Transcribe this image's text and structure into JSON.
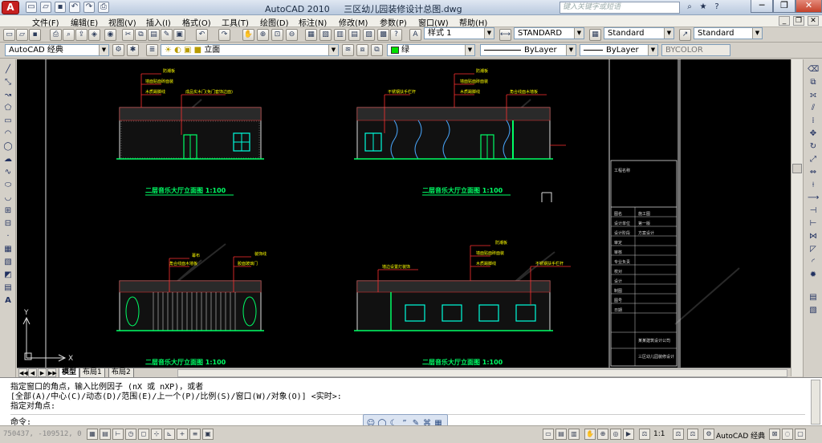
{
  "titlebar": {
    "app_letter": "A",
    "app_name": "AutoCAD 2010",
    "doc_name": "三区幼儿园装修设计总图.dwg",
    "search_placeholder": "键入关键字或短语",
    "quick_access": [
      "new-icon",
      "open-icon",
      "save-icon",
      "undo-icon",
      "redo-icon",
      "plot-icon"
    ],
    "right_icons": [
      "binoculars-icon",
      "star-icon",
      "help-icon"
    ],
    "controls": {
      "minimize": "─",
      "restore": "❐",
      "close": "✕"
    }
  },
  "menubar": {
    "items": [
      "文件(F)",
      "编辑(E)",
      "视图(V)",
      "插入(I)",
      "格式(O)",
      "工具(T)",
      "绘图(D)",
      "标注(N)",
      "修改(M)",
      "参数(P)",
      "窗口(W)",
      "帮助(H)"
    ]
  },
  "toolbar1": {
    "text_style": "样式 1",
    "dim_style": "STANDARD",
    "table_style": "Standard",
    "mleader_style": "Standard"
  },
  "toolbar2": {
    "workspace": "AutoCAD 经典",
    "layer": "立面",
    "color": "绿",
    "linetype": "ByLayer",
    "lineweight": "ByLayer",
    "plotstyle": "BYCOLOR",
    "color_hex": "#00e000"
  },
  "drawings": [
    {
      "title": "二层音乐大厅立面图  1:100",
      "notes": [
        "防潮板",
        "墙面贴面砖面装",
        "木质踢脚线",
        "成品实木门(免门套饰边面)"
      ]
    },
    {
      "title": "二层音乐大厅立面图  1:100",
      "notes": [
        "防潮板",
        "墙面贴面砖面装",
        "木质踢脚线",
        "不锈钢扶手栏杆",
        "角合线面木墙板"
      ]
    },
    {
      "title": "二层音乐大厅立面图  1:100",
      "notes": [
        "幕布",
        "角合线面木墙板",
        "胶面玻璃门",
        "装饰线"
      ]
    },
    {
      "title": "二层音乐大厅立面图  1:100",
      "notes": [
        "防潮板",
        "墙面贴面砖面装",
        "木质踢脚线",
        "不锈钢扶手栏杆",
        "墙边设置灯装饰"
      ]
    }
  ],
  "titleblock": {
    "rows": [
      "工程名称",
      "图名",
      "设计单位",
      "设计阶段",
      "审定",
      "审核",
      "专业负责",
      "校对",
      "设计",
      "制图",
      "图号",
      "日期"
    ],
    "values": [
      "施工图",
      "第一版",
      "方案设计"
    ],
    "company": "某某建筑设计公司",
    "project": "三区幼儿园装修设计"
  },
  "ucs": {
    "x": "X",
    "y": "Y"
  },
  "layout_tabs": [
    "模型",
    "布局1",
    "布局2"
  ],
  "command": {
    "lines": [
      "指定窗口的角点，输入比例因子 (nX 或 nXP)，或者",
      "[全部(A)/中心(C)/动态(D)/范围(E)/上一个(P)/比例(S)/窗口(W)/对象(O)] <实时>:",
      "指定对角点:"
    ],
    "prompt": "命令:"
  },
  "status": {
    "coords": "750437, -109512, 0",
    "scale": "1:1",
    "workspace": "AutoCAD 经典"
  }
}
